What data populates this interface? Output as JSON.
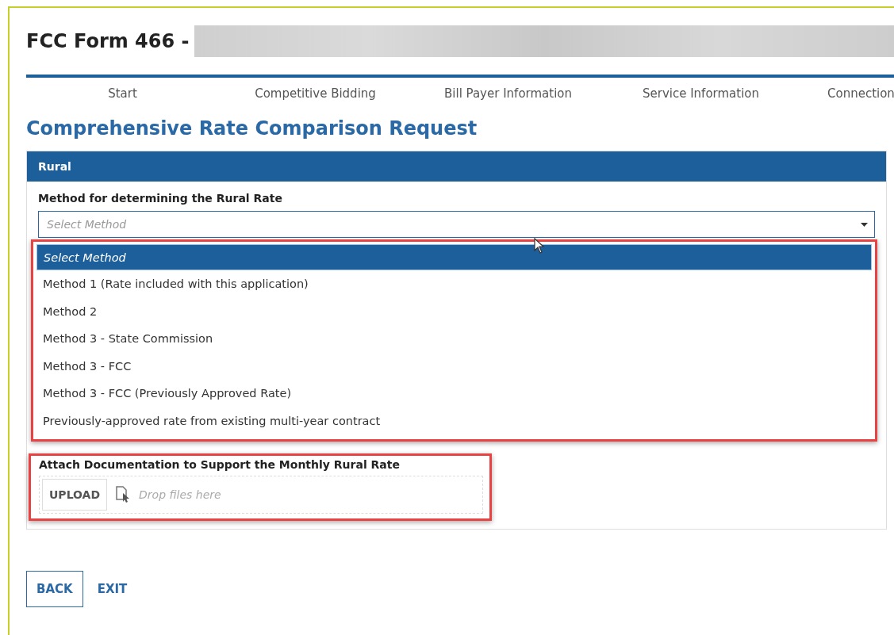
{
  "header": {
    "title": "FCC Form 466 -",
    "redacted": true
  },
  "steps": [
    {
      "label": "Start"
    },
    {
      "label": "Competitive Bidding"
    },
    {
      "label": "Bill Payer Information"
    },
    {
      "label": "Service Information"
    },
    {
      "label": "Connection"
    }
  ],
  "heading": "Comprehensive Rate Comparison Request",
  "panel": {
    "title": "Rural",
    "method_field": {
      "label": "Method for determining the Rural Rate",
      "placeholder": "Select Method",
      "expanded": true,
      "options": [
        {
          "label": "Select Method",
          "selected": true
        },
        {
          "label": "Method 1 (Rate included with this application)",
          "selected": false
        },
        {
          "label": "Method 2",
          "selected": false
        },
        {
          "label": "Method 3 - State Commission",
          "selected": false
        },
        {
          "label": "Method 3 - FCC",
          "selected": false
        },
        {
          "label": "Method 3 - FCC (Previously Approved Rate)",
          "selected": false
        },
        {
          "label": "Previously-approved rate from existing multi-year contract",
          "selected": false
        }
      ]
    },
    "attach": {
      "label": "Attach Documentation to Support the Monthly Rural Rate",
      "button": "UPLOAD",
      "placeholder": "Drop files here"
    }
  },
  "buttons": [
    {
      "label": "BACK",
      "kind": "outlined"
    },
    {
      "label": "EXIT",
      "kind": "link"
    }
  ]
}
